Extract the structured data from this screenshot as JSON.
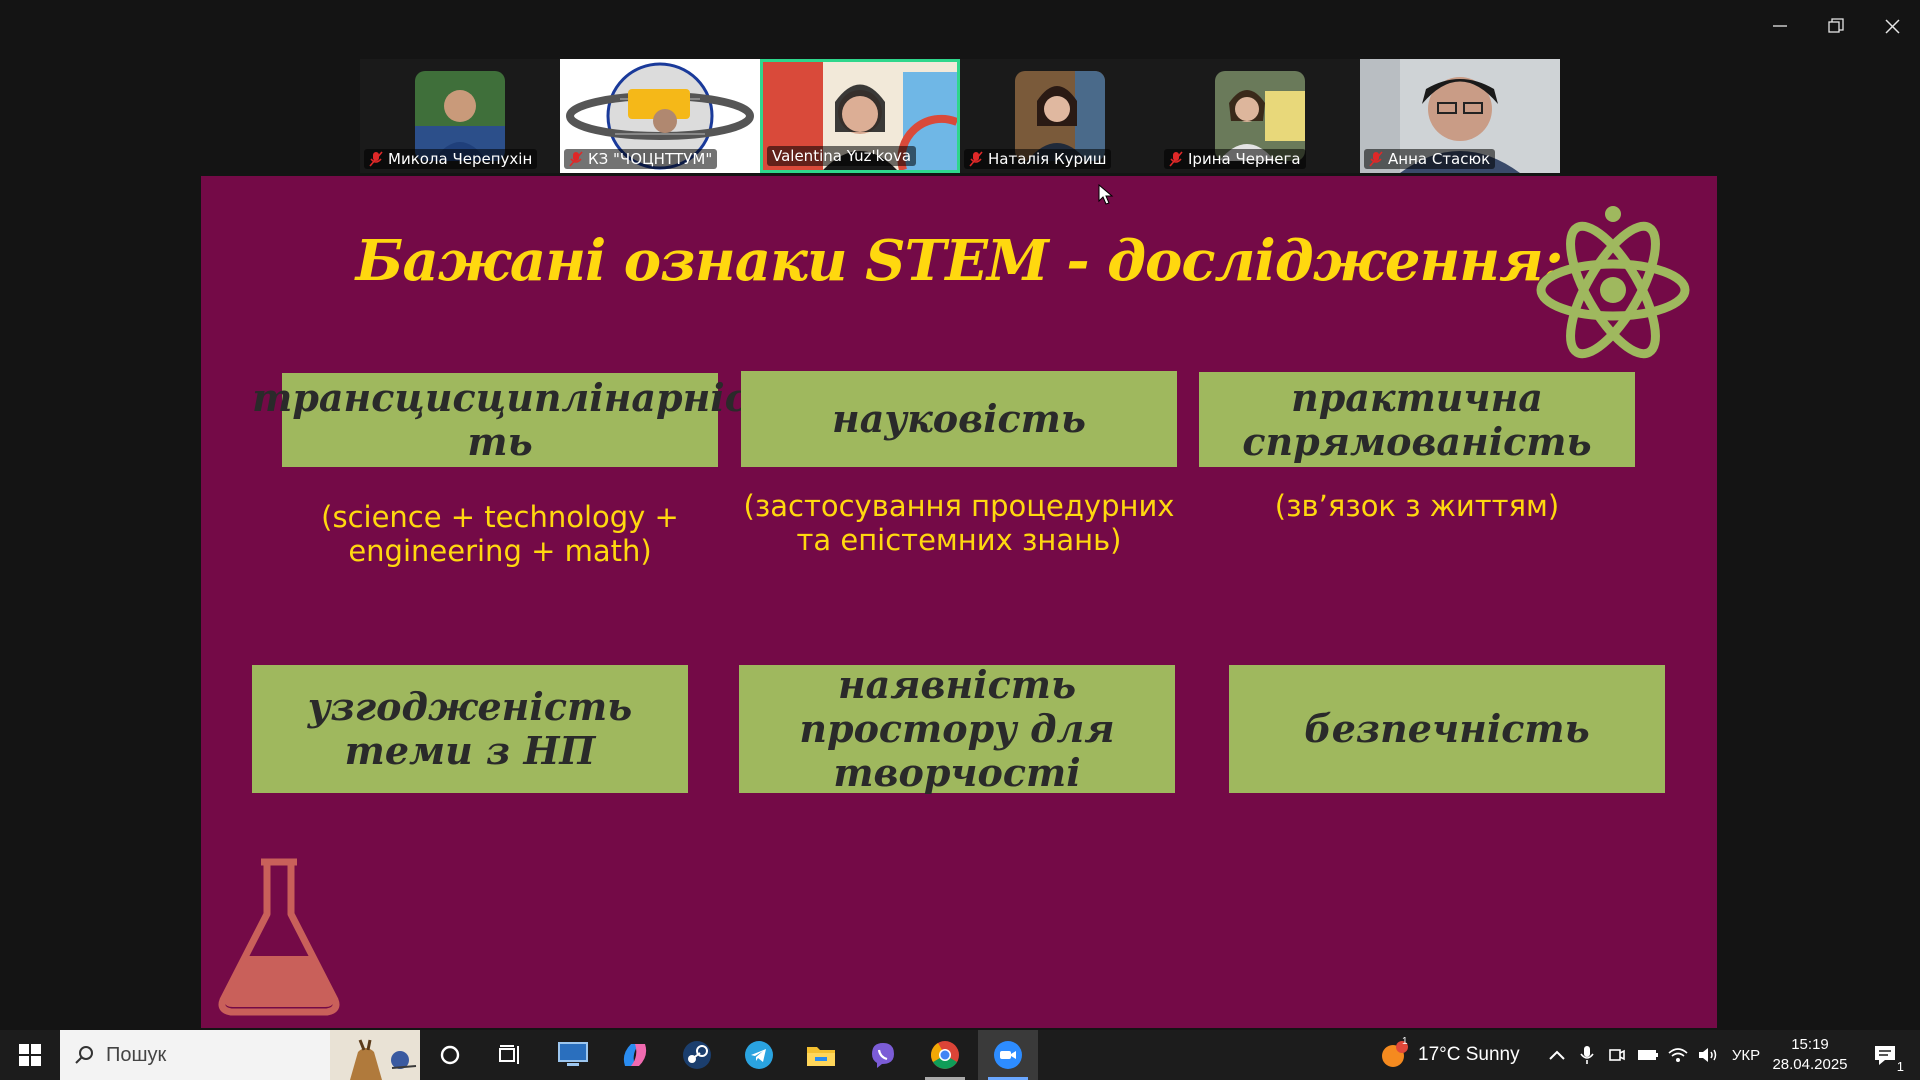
{
  "participants": [
    {
      "name": "Микола Черепухін",
      "muted": true
    },
    {
      "name": "КЗ \"ЧОЦНТТУМ\"",
      "muted": true
    },
    {
      "name": "Valentina  Yuz'kova",
      "muted": false,
      "active": true
    },
    {
      "name": "Наталія Куриш",
      "muted": true
    },
    {
      "name": "Ірина Чернега",
      "muted": true
    },
    {
      "name": "Анна Стасюк",
      "muted": true
    }
  ],
  "slide": {
    "title": "Бажані ознаки STEM - дослідження:",
    "cards": [
      {
        "label": "трансцисциплінарніс ть",
        "sub": "(science + technology + engineering + math)"
      },
      {
        "label": "науковість",
        "sub": "(застосування процедурних та епістемних знань)"
      },
      {
        "label": "практична спрямованість",
        "sub": "(зв’язок з життям)"
      },
      {
        "label": "узгодженість теми з НП"
      },
      {
        "label": "наявність простору для творчості"
      },
      {
        "label": "безпечність"
      }
    ]
  },
  "taskbar": {
    "search_placeholder": "Пошук",
    "weather": "17°C  Sunny",
    "weather_badge": "1",
    "language": "УКР",
    "time": "15:19",
    "date": "28.04.2025",
    "notification_count": "1"
  },
  "colors": {
    "slide_bg": "#740a47",
    "title": "#ffd80f",
    "card": "#9fb85e",
    "active_speaker": "#2fd68c"
  }
}
